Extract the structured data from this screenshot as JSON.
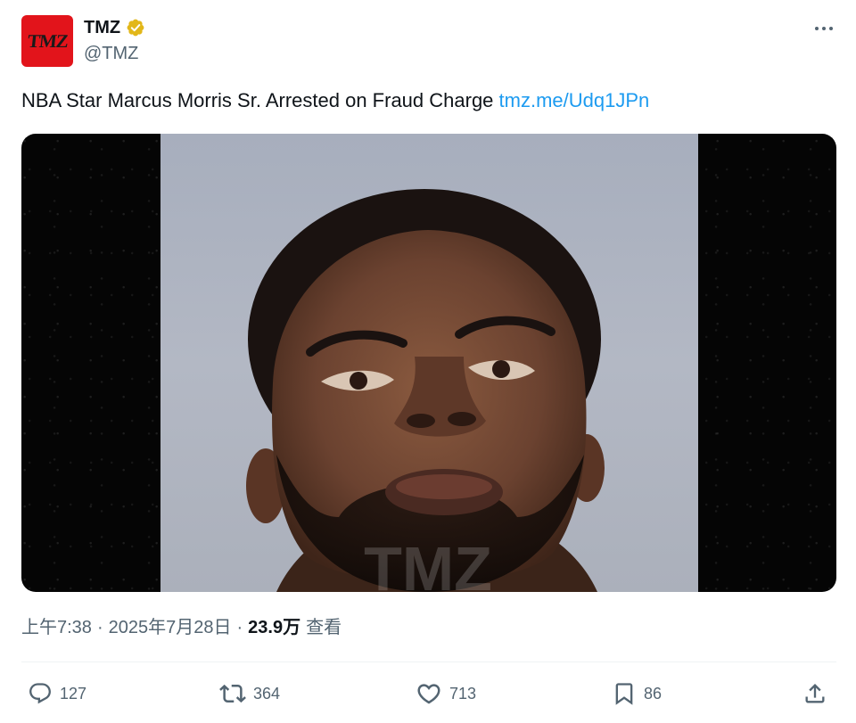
{
  "author": {
    "avatar_text": "TMZ",
    "display_name": "TMZ",
    "handle": "@TMZ",
    "verified": true,
    "verified_badge_color": "#e2b719",
    "avatar_color": "#e2141b"
  },
  "tweet": {
    "text": "NBA Star Marcus Morris Sr. Arrested on Fraud Charge ",
    "link_text": "tmz.me/Udq1JPn",
    "link_color": "#1d9bf0"
  },
  "meta": {
    "time": "上午7:38",
    "separator": "·",
    "date": "2025年7月28日",
    "views_count": "23.9万",
    "views_label": "查看"
  },
  "actions": {
    "reply_count": "127",
    "retweet_count": "364",
    "like_count": "713",
    "bookmark_count": "86"
  },
  "icons": {
    "more": "more-horizontal-icon",
    "reply": "reply-icon",
    "retweet": "retweet-icon",
    "like": "heart-icon",
    "bookmark": "bookmark-icon",
    "share": "share-icon",
    "verified": "verified-badge-icon"
  }
}
